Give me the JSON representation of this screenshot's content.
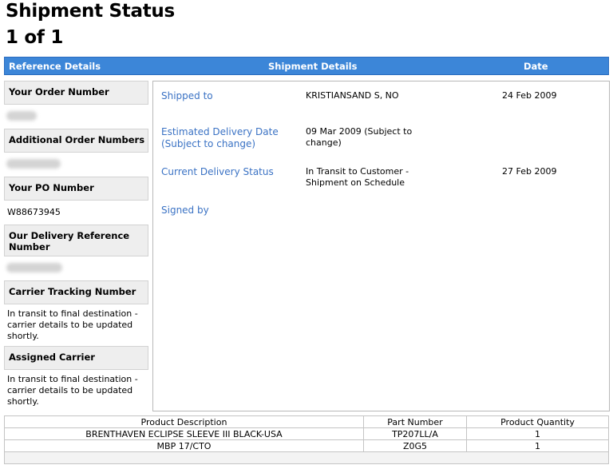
{
  "page": {
    "title": "Shipment Status",
    "pager": "1 of 1"
  },
  "header": {
    "col1": "Reference Details",
    "col2": "Shipment Details",
    "col3": "Date"
  },
  "reference": {
    "order_number_label": "Your Order Number",
    "additional_numbers_label": "Additional Order Numbers",
    "po_label": "Your PO Number",
    "po_value": "W88673945",
    "delivery_ref_label": "Our Delivery Reference Number",
    "carrier_tracking_label": "Carrier Tracking Number",
    "carrier_tracking_value": "In transit to final destination - carrier details to be updated shortly.",
    "assigned_carrier_label": "Assigned Carrier",
    "assigned_carrier_value": "In transit to final destination - carrier details to be updated shortly."
  },
  "shipment": {
    "rows": [
      {
        "label": "Shipped to",
        "value": "KRISTIANSAND S, NO",
        "date": "24 Feb 2009"
      },
      {
        "label": "Estimated Delivery Date (Subject to change)",
        "value": "09 Mar 2009 (Subject to change)",
        "date": ""
      },
      {
        "label": "Current Delivery Status",
        "value": "In Transit to Customer - Shipment on Schedule",
        "date": "27 Feb 2009"
      },
      {
        "label": "Signed by",
        "value": "",
        "date": ""
      }
    ]
  },
  "products": {
    "headers": [
      "Product Description",
      "Part Number",
      "Product Quantity"
    ],
    "rows": [
      [
        "BRENTHAVEN ECLIPSE SLEEVE III BLACK-USA",
        "TP207LL/A",
        "1"
      ],
      [
        "MBP 17/CTO",
        "Z0G5",
        "1"
      ]
    ]
  },
  "colors": {
    "header_blue": "#3c86d8",
    "label_blue": "#3a72c4",
    "box_gray": "#eeeeee"
  }
}
